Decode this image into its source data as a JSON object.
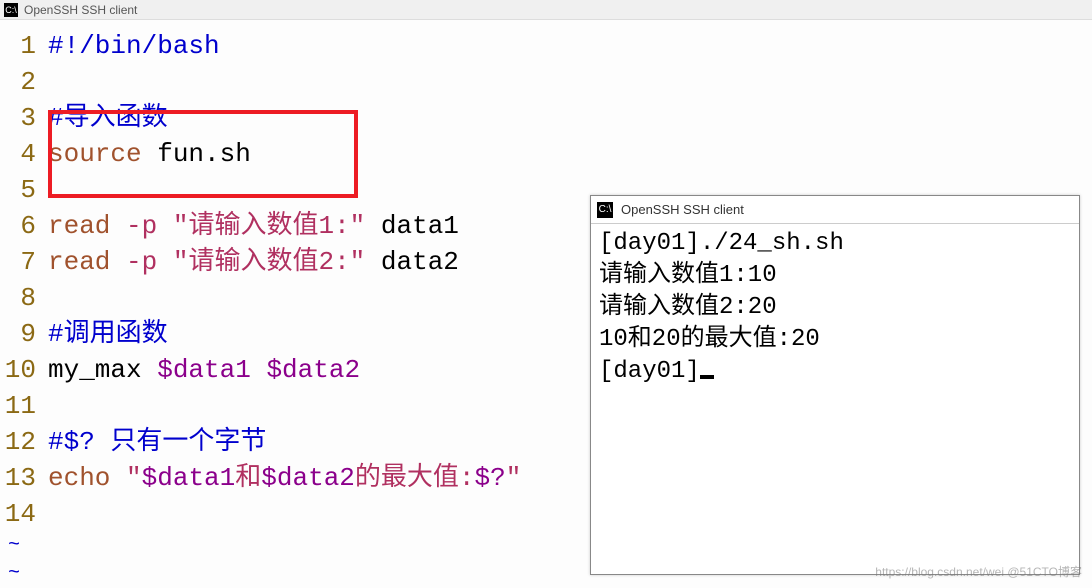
{
  "window": {
    "title": "OpenSSH SSH client",
    "icon_label": "C:\\"
  },
  "code": {
    "lines": [
      {
        "num": "1",
        "tokens": [
          {
            "cls": "comment",
            "text": "#!/bin/bash"
          }
        ]
      },
      {
        "num": "2",
        "tokens": []
      },
      {
        "num": "3",
        "tokens": [
          {
            "cls": "comment",
            "text": "#导入函数"
          }
        ]
      },
      {
        "num": "4",
        "tokens": [
          {
            "cls": "keyword",
            "text": "source"
          },
          {
            "cls": "plain",
            "text": " fun.sh"
          }
        ]
      },
      {
        "num": "5",
        "tokens": []
      },
      {
        "num": "6",
        "tokens": [
          {
            "cls": "keyword",
            "text": "read"
          },
          {
            "cls": "plain",
            "text": " "
          },
          {
            "cls": "flag",
            "text": "-p"
          },
          {
            "cls": "plain",
            "text": " "
          },
          {
            "cls": "string",
            "text": "\"请输入数值"
          },
          {
            "cls": "number",
            "text": "1"
          },
          {
            "cls": "string",
            "text": ":\""
          },
          {
            "cls": "plain",
            "text": " data1"
          }
        ]
      },
      {
        "num": "7",
        "tokens": [
          {
            "cls": "keyword",
            "text": "read"
          },
          {
            "cls": "plain",
            "text": " "
          },
          {
            "cls": "flag",
            "text": "-p"
          },
          {
            "cls": "plain",
            "text": " "
          },
          {
            "cls": "string",
            "text": "\"请输入数值"
          },
          {
            "cls": "number",
            "text": "2"
          },
          {
            "cls": "string",
            "text": ":\""
          },
          {
            "cls": "plain",
            "text": " data2"
          }
        ]
      },
      {
        "num": "8",
        "tokens": []
      },
      {
        "num": "9",
        "tokens": [
          {
            "cls": "comment",
            "text": "#调用函数"
          }
        ]
      },
      {
        "num": "10",
        "tokens": [
          {
            "cls": "plain",
            "text": "my_max "
          },
          {
            "cls": "variable",
            "text": "$data1"
          },
          {
            "cls": "plain",
            "text": " "
          },
          {
            "cls": "variable",
            "text": "$data2"
          }
        ]
      },
      {
        "num": "11",
        "tokens": []
      },
      {
        "num": "12",
        "tokens": [
          {
            "cls": "comment",
            "text": "#$? 只有一个字节"
          }
        ]
      },
      {
        "num": "13",
        "tokens": [
          {
            "cls": "keyword",
            "text": "echo"
          },
          {
            "cls": "plain",
            "text": " "
          },
          {
            "cls": "string",
            "text": "\""
          },
          {
            "cls": "variable",
            "text": "$data1"
          },
          {
            "cls": "string",
            "text": "和"
          },
          {
            "cls": "variable",
            "text": "$data2"
          },
          {
            "cls": "string",
            "text": "的最大值:"
          },
          {
            "cls": "variable",
            "text": "$?"
          },
          {
            "cls": "string",
            "text": "\""
          }
        ]
      },
      {
        "num": "14",
        "tokens": []
      }
    ],
    "tilde": "~"
  },
  "terminal": {
    "title": "OpenSSH SSH client",
    "icon_label": "C:\\",
    "lines": [
      "[day01]./24_sh.sh",
      "请输入数值1:10",
      "请输入数值2:20",
      "10和20的最大值:20",
      "[day01]"
    ]
  },
  "watermark": "https://blog.csdn.net/wei  @51CTO博客"
}
